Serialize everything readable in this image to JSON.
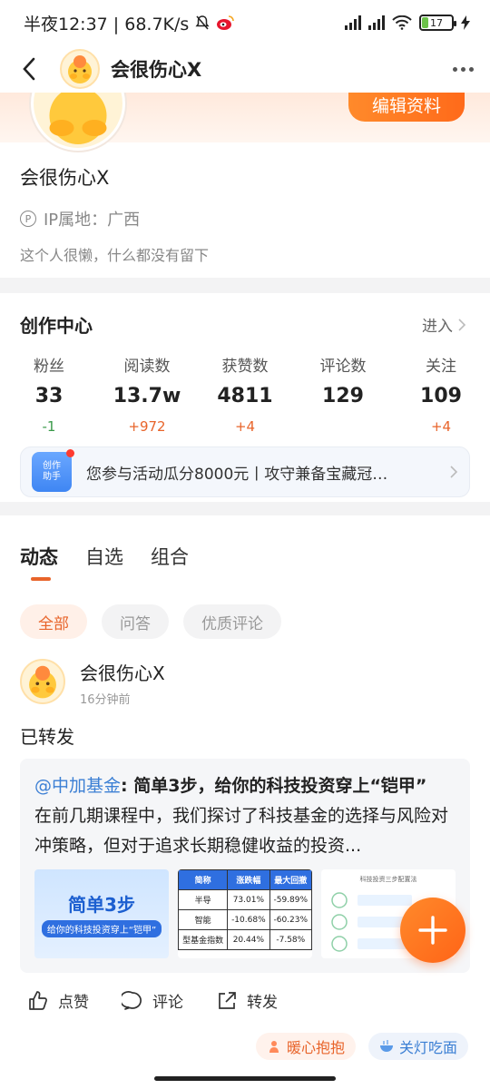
{
  "status_bar": {
    "left_text": "半夜12:37 | 68.7K/s",
    "battery": "17"
  },
  "header": {
    "title": "会很伤心X"
  },
  "profile": {
    "edit_button": "编辑资料",
    "name": "会很伤心X",
    "ip_label": "IP属地：广西",
    "bio": "这个人很懒，什么都没有留下"
  },
  "creation_center": {
    "title": "创作中心",
    "enter": "进入",
    "stats": [
      {
        "label": "粉丝",
        "value": "33",
        "delta": "-1"
      },
      {
        "label": "阅读数",
        "value": "13.7w",
        "delta": "+972"
      },
      {
        "label": "获赞数",
        "value": "4811",
        "delta": "+4"
      },
      {
        "label": "评论数",
        "value": "129",
        "delta": ""
      },
      {
        "label": "关注",
        "value": "109",
        "delta": "+4"
      }
    ],
    "banner": {
      "badge_line1": "创作",
      "badge_line2": "助手",
      "text": "您参与活动瓜分8000元丨攻守兼备宝藏冠…"
    }
  },
  "feed": {
    "tabs": [
      "动态",
      "自选",
      "组合"
    ],
    "filters": [
      "全部",
      "问答",
      "优质评论"
    ],
    "post": {
      "author": "会很伤心X",
      "time": "16分钟前",
      "text": "已转发",
      "quote": {
        "mention": "@中加基金",
        "title": ": 简单3步，给你的科技投资穿上“铠甲”",
        "body": "在前几期课程中，我们探讨了科技基金的选择与风险对冲策略，但对于追求长期稳健收益的投资..."
      },
      "image1": {
        "line1": "简单3步",
        "line2": "给你的科技投资穿上“铠甲”"
      },
      "image2": {
        "headers": [
          "简称",
          "涨跌幅",
          "最大回撤"
        ],
        "rows": [
          [
            "半导",
            "73.01%",
            "-59.89%"
          ],
          [
            "智能",
            "-10.68%",
            "-60.23%"
          ],
          [
            "型基金指数",
            "20.44%",
            "-7.58%"
          ]
        ]
      },
      "image3": {
        "title": "科技投资三步配置法"
      }
    },
    "actions": {
      "like": "点赞",
      "comment": "评论",
      "share": "转发"
    },
    "reactions": {
      "warm": "暖心抱抱",
      "cool": "关灯吃面"
    }
  },
  "colors": {
    "accent": "#ff6a1a",
    "link": "#3b7fd4",
    "up": "#e8642a",
    "down": "#3a9a4a"
  }
}
